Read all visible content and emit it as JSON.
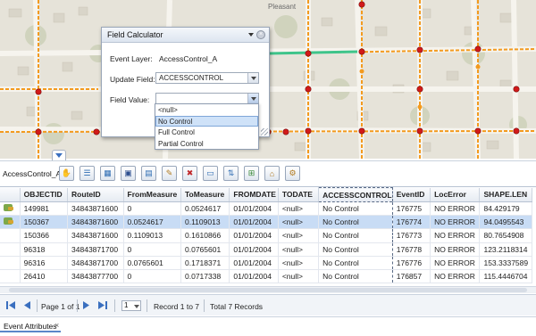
{
  "map": {
    "place_label": "Pleasant"
  },
  "dialog": {
    "title": "Field Calculator",
    "event_layer_label": "Event Layer:",
    "event_layer_value": "AccessControl_A",
    "update_field_label": "Update Field:",
    "update_field_value": "ACCESSCONTROL",
    "field_value_label": "Field Value:",
    "field_value_value": "",
    "options": [
      "<null>",
      "No Control",
      "Full Control",
      "Partial Control"
    ],
    "selected_option": "No Control"
  },
  "toolbar": {
    "layer_name": "AccessControl_A",
    "buttons": [
      "zoom-to-selection-icon",
      "table-options-icon",
      "select-all-icon",
      "save-icon",
      "export-icon",
      "edit-icon",
      "delete-icon",
      "field-calculator-icon",
      "sort-icon",
      "add-field-icon",
      "attribute-icon",
      "settings-icon"
    ]
  },
  "table": {
    "columns": [
      "",
      "OBJECTID",
      "RouteID",
      "FromMeasure",
      "ToMeasure",
      "FROMDATE",
      "TODATE",
      "ACCESSCONTROL",
      "EventID",
      "LocError",
      "SHAPE.LEN"
    ],
    "rows": [
      [
        "149981",
        "34843871600",
        "0",
        "0.0524617",
        "01/01/2004",
        "<null>",
        "No Control",
        "176775",
        "NO ERROR",
        "84.429179"
      ],
      [
        "150367",
        "34843871600",
        "0.0524617",
        "0.1109013",
        "01/01/2004",
        "<null>",
        "No Control",
        "176774",
        "NO ERROR",
        "94.0495543"
      ],
      [
        "150366",
        "34843871600",
        "0.1109013",
        "0.1610866",
        "01/01/2004",
        "<null>",
        "No Control",
        "176773",
        "NO ERROR",
        "80.7654908"
      ],
      [
        "96318",
        "34843871700",
        "0",
        "0.0765601",
        "01/01/2004",
        "<null>",
        "No Control",
        "176778",
        "NO ERROR",
        "123.2118314"
      ],
      [
        "96316",
        "34843871700",
        "0.0765601",
        "0.1718371",
        "01/01/2004",
        "<null>",
        "No Control",
        "176776",
        "NO ERROR",
        "153.3337589"
      ],
      [
        "26410",
        "34843877700",
        "0",
        "0.0717338",
        "01/01/2004",
        "<null>",
        "No Control",
        "176857",
        "NO ERROR",
        "115.4446704"
      ]
    ],
    "selected_row_index": 1,
    "highlighted_column": "ACCESSCONTROL"
  },
  "pager": {
    "page_text": "Page 1 of 1",
    "page_select": "1",
    "record_text": "Record 1 to 7",
    "total_text": "Total 7 Records"
  },
  "bottom_tab": {
    "label": "Event Attributes",
    "close": "×"
  },
  "colors": {
    "selection": "#c8dcf5",
    "accent": "#3a6fbf",
    "route_red": "#d11a1a",
    "route_orange": "#f39a1e"
  }
}
